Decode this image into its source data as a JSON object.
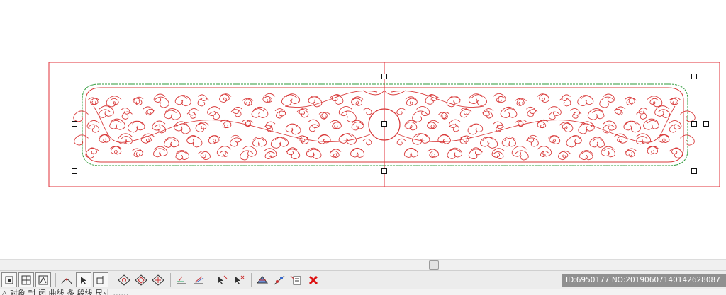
{
  "canvas": {
    "selection_color": "#e0303a",
    "ornament_color": "#d93a3a",
    "outline_color": "#2f9a3a"
  },
  "toolbar": {
    "tools": [
      {
        "name": "node-edit-icon"
      },
      {
        "name": "grid-icon"
      },
      {
        "name": "snap-icon"
      },
      {
        "name": "curve-icon"
      },
      {
        "name": "arrow-icon"
      },
      {
        "name": "zoom-box-icon"
      },
      {
        "name": "pan-icon"
      },
      {
        "name": "diamond-icon"
      },
      {
        "name": "diamond-outline-icon"
      },
      {
        "name": "diamond-cross-icon"
      },
      {
        "name": "layers-icon"
      },
      {
        "name": "layers-stack-icon"
      },
      {
        "name": "select-pointer-icon"
      },
      {
        "name": "select-pointer-x-icon"
      },
      {
        "name": "transform-icon"
      },
      {
        "name": "path-edit-icon"
      },
      {
        "name": "properties-icon"
      },
      {
        "name": "delete-icon"
      }
    ]
  },
  "watermark": {
    "text": "ID:6950177 NO:20190607140142628087"
  },
  "status": {
    "text": "△ 对象 封 闭   曲线 多 段线  尺寸 ……"
  }
}
